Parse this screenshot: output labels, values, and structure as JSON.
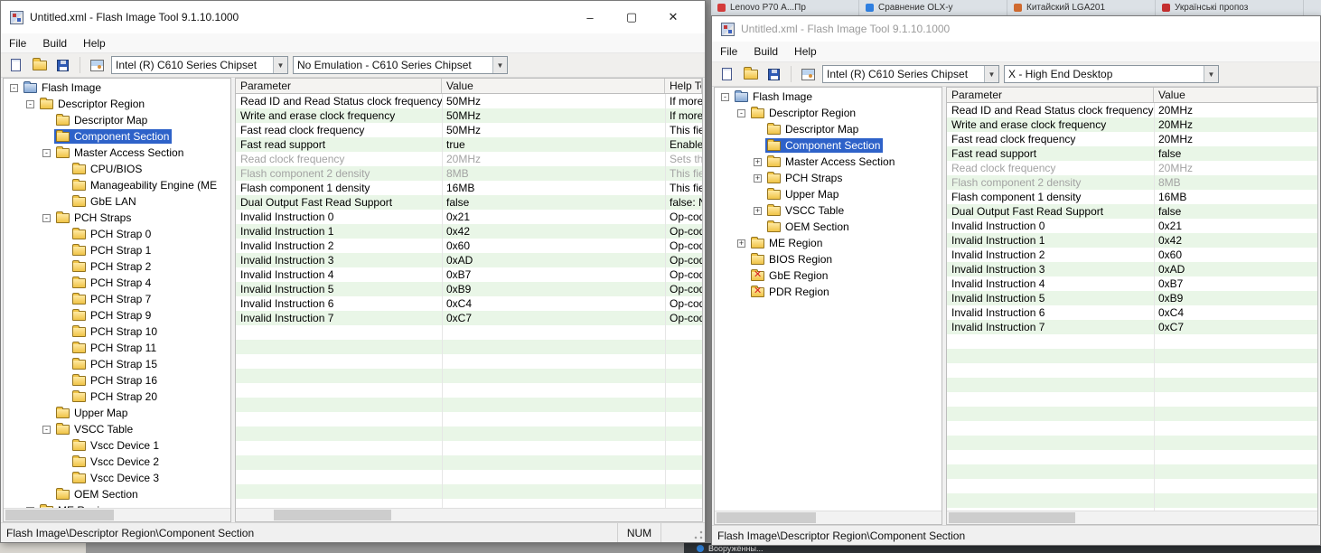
{
  "icons": {
    "minimize": "–",
    "maximize": "▢",
    "close": "✕",
    "combo_arrow": "▼",
    "collapse": "-",
    "expand": "+",
    "invalid_x": "✕"
  },
  "background": {
    "browser_tabs": [
      {
        "label": "Lenovo P70 А...Пр",
        "color": "#d43b3b"
      },
      {
        "label": "Сравнение OLX-у",
        "color": "#2f7fe0"
      },
      {
        "label": "Китайский LGA201",
        "color": "#d06a2f"
      },
      {
        "label": "Українські пропоз",
        "color": "#c42f2f"
      }
    ],
    "bottom_fragment": "Вооружённы..."
  },
  "left_window": {
    "title": "Untitled.xml - Flash Image Tool 9.1.10.1000",
    "menu": [
      "File",
      "Build",
      "Help"
    ],
    "toolbar": {
      "chipset_value": "Intel (R) C610 Series Chipset",
      "emulation_value": "No Emulation - C610 Series Chipset"
    },
    "tree": [
      {
        "label": "Flash Image",
        "level": 0,
        "exp": "minus",
        "icon": "flash"
      },
      {
        "label": "Descriptor Region",
        "level": 1,
        "exp": "minus",
        "icon": "folder"
      },
      {
        "label": "Descriptor Map",
        "level": 2,
        "exp": "none",
        "icon": "folder"
      },
      {
        "label": "Component Section",
        "level": 2,
        "exp": "none",
        "icon": "folder",
        "selected": true
      },
      {
        "label": "Master Access Section",
        "level": 2,
        "exp": "minus",
        "icon": "folder"
      },
      {
        "label": "CPU/BIOS",
        "level": 3,
        "exp": "none",
        "icon": "folder"
      },
      {
        "label": "Manageability Engine (ME",
        "level": 3,
        "exp": "none",
        "icon": "folder"
      },
      {
        "label": "GbE LAN",
        "level": 3,
        "exp": "none",
        "icon": "folder"
      },
      {
        "label": "PCH Straps",
        "level": 2,
        "exp": "minus",
        "icon": "folder"
      },
      {
        "label": "PCH Strap 0",
        "level": 3,
        "exp": "none",
        "icon": "folder"
      },
      {
        "label": "PCH Strap 1",
        "level": 3,
        "exp": "none",
        "icon": "folder"
      },
      {
        "label": "PCH Strap 2",
        "level": 3,
        "exp": "none",
        "icon": "folder"
      },
      {
        "label": "PCH Strap 4",
        "level": 3,
        "exp": "none",
        "icon": "folder"
      },
      {
        "label": "PCH Strap 7",
        "level": 3,
        "exp": "none",
        "icon": "folder"
      },
      {
        "label": "PCH Strap 9",
        "level": 3,
        "exp": "none",
        "icon": "folder"
      },
      {
        "label": "PCH Strap 10",
        "level": 3,
        "exp": "none",
        "icon": "folder"
      },
      {
        "label": "PCH Strap 11",
        "level": 3,
        "exp": "none",
        "icon": "folder"
      },
      {
        "label": "PCH Strap 15",
        "level": 3,
        "exp": "none",
        "icon": "folder"
      },
      {
        "label": "PCH Strap 16",
        "level": 3,
        "exp": "none",
        "icon": "folder"
      },
      {
        "label": "PCH Strap 20",
        "level": 3,
        "exp": "none",
        "icon": "folder"
      },
      {
        "label": "Upper Map",
        "level": 2,
        "exp": "none",
        "icon": "folder"
      },
      {
        "label": "VSCC Table",
        "level": 2,
        "exp": "minus",
        "icon": "folder"
      },
      {
        "label": "Vscc Device 1",
        "level": 3,
        "exp": "none",
        "icon": "folder"
      },
      {
        "label": "Vscc Device 2",
        "level": 3,
        "exp": "none",
        "icon": "folder"
      },
      {
        "label": "Vscc Device 3",
        "level": 3,
        "exp": "none",
        "icon": "folder"
      },
      {
        "label": "OEM Section",
        "level": 2,
        "exp": "none",
        "icon": "folder"
      },
      {
        "label": "ME Region",
        "level": 1,
        "exp": "plus",
        "icon": "folder"
      }
    ],
    "table": {
      "columns": [
        "Parameter",
        "Value",
        "Help Te"
      ],
      "rows": [
        {
          "param": "Read ID and Read Status clock frequency",
          "value": "50MHz",
          "help": "If more",
          "gray": false
        },
        {
          "param": "Write and erase clock frequency",
          "value": "50MHz",
          "help": "If more",
          "gray": false
        },
        {
          "param": "Fast read clock frequency",
          "value": "50MHz",
          "help": "This fie",
          "gray": false
        },
        {
          "param": "Fast read support",
          "value": "true",
          "help": "Enables",
          "gray": false
        },
        {
          "param": "Read clock frequency",
          "value": "20MHz",
          "help": "Sets th",
          "gray": true
        },
        {
          "param": "Flash component 2 density",
          "value": "8MB",
          "help": "This fie",
          "gray": true
        },
        {
          "param": "Flash component 1 density",
          "value": "16MB",
          "help": "This fie",
          "gray": false
        },
        {
          "param": "Dual Output Fast Read Support",
          "value": "false",
          "help": "false: N",
          "gray": false
        },
        {
          "param": "Invalid Instruction 0",
          "value": "0x21",
          "help": "Op-cod",
          "gray": false
        },
        {
          "param": "Invalid Instruction 1",
          "value": "0x42",
          "help": "Op-cod",
          "gray": false
        },
        {
          "param": "Invalid Instruction 2",
          "value": "0x60",
          "help": "Op-cod",
          "gray": false
        },
        {
          "param": "Invalid Instruction 3",
          "value": "0xAD",
          "help": "Op-cod",
          "gray": false
        },
        {
          "param": "Invalid Instruction 4",
          "value": "0xB7",
          "help": "Op-cod",
          "gray": false
        },
        {
          "param": "Invalid Instruction 5",
          "value": "0xB9",
          "help": "Op-cod",
          "gray": false
        },
        {
          "param": "Invalid Instruction 6",
          "value": "0xC4",
          "help": "Op-cod",
          "gray": false
        },
        {
          "param": "Invalid Instruction 7",
          "value": "0xC7",
          "help": "Op-cod",
          "gray": false
        }
      ]
    },
    "status_path": "Flash Image\\Descriptor Region\\Component Section",
    "status_num": "NUM"
  },
  "right_window": {
    "title": "Untitled.xml - Flash Image Tool 9.1.10.1000",
    "menu": [
      "File",
      "Build",
      "Help"
    ],
    "toolbar": {
      "chipset_value": "Intel (R) C610 Series Chipset",
      "emulation_value": "X - High End Desktop"
    },
    "tree": [
      {
        "label": "Flash Image",
        "level": 0,
        "exp": "minus",
        "icon": "flash"
      },
      {
        "label": "Descriptor Region",
        "level": 1,
        "exp": "minus",
        "icon": "folder"
      },
      {
        "label": "Descriptor Map",
        "level": 2,
        "exp": "none",
        "icon": "folder"
      },
      {
        "label": "Component Section",
        "level": 2,
        "exp": "none",
        "icon": "folder",
        "selected": true
      },
      {
        "label": "Master Access Section",
        "level": 2,
        "exp": "plus",
        "icon": "folder"
      },
      {
        "label": "PCH Straps",
        "level": 2,
        "exp": "plus",
        "icon": "folder"
      },
      {
        "label": "Upper Map",
        "level": 2,
        "exp": "none",
        "icon": "folder"
      },
      {
        "label": "VSCC Table",
        "level": 2,
        "exp": "plus",
        "icon": "folder"
      },
      {
        "label": "OEM Section",
        "level": 2,
        "exp": "none",
        "icon": "folder"
      },
      {
        "label": "ME Region",
        "level": 1,
        "exp": "plus",
        "icon": "folder"
      },
      {
        "label": "BIOS Region",
        "level": 1,
        "exp": "none",
        "icon": "folder"
      },
      {
        "label": "GbE Region",
        "level": 1,
        "exp": "none",
        "icon": "folder-x"
      },
      {
        "label": "PDR Region",
        "level": 1,
        "exp": "none",
        "icon": "folder-x"
      }
    ],
    "table": {
      "columns": [
        "Parameter",
        "Value"
      ],
      "rows": [
        {
          "param": "Read ID and Read Status clock frequency",
          "value": "20MHz",
          "gray": false
        },
        {
          "param": "Write and erase clock frequency",
          "value": "20MHz",
          "gray": false
        },
        {
          "param": "Fast read clock frequency",
          "value": "20MHz",
          "gray": false
        },
        {
          "param": "Fast read support",
          "value": "false",
          "gray": false
        },
        {
          "param": "Read clock frequency",
          "value": "20MHz",
          "gray": true
        },
        {
          "param": "Flash component 2 density",
          "value": "8MB",
          "gray": true
        },
        {
          "param": "Flash component 1 density",
          "value": "16MB",
          "gray": false
        },
        {
          "param": "Dual Output Fast Read Support",
          "value": "false",
          "gray": false
        },
        {
          "param": "Invalid Instruction 0",
          "value": "0x21",
          "gray": false
        },
        {
          "param": "Invalid Instruction 1",
          "value": "0x42",
          "gray": false
        },
        {
          "param": "Invalid Instruction 2",
          "value": "0x60",
          "gray": false
        },
        {
          "param": "Invalid Instruction 3",
          "value": "0xAD",
          "gray": false
        },
        {
          "param": "Invalid Instruction 4",
          "value": "0xB7",
          "gray": false
        },
        {
          "param": "Invalid Instruction 5",
          "value": "0xB9",
          "gray": false
        },
        {
          "param": "Invalid Instruction 6",
          "value": "0xC4",
          "gray": false
        },
        {
          "param": "Invalid Instruction 7",
          "value": "0xC7",
          "gray": false
        }
      ]
    },
    "status_path": "Flash Image\\Descriptor Region\\Component Section"
  }
}
